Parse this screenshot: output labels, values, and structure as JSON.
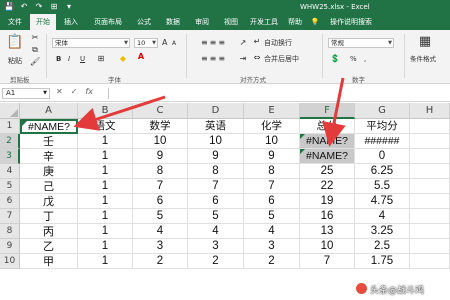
{
  "window": {
    "title": "WHW25.xlsx  -  Excel",
    "qat": [
      "💾",
      "↶",
      "↷",
      "⊞",
      "▾"
    ]
  },
  "tabs": [
    "文件",
    "开始",
    "插入",
    "页面布局",
    "公式",
    "数据",
    "审阅",
    "视图",
    "开发工具",
    "帮助",
    "操作说明搜索"
  ],
  "ribbon": {
    "clipboard": {
      "label": "剪贴板",
      "paste": "粘贴"
    },
    "font": {
      "label": "字体",
      "font_name": "宋体",
      "font_size": "10",
      "bold": "B",
      "italic": "I",
      "underline": "U",
      "grow": "A",
      "shrink": "A"
    },
    "alignment": {
      "label": "对齐方式",
      "wrap": "自动换行",
      "merge": "合并后居中"
    },
    "number": {
      "label": "数字",
      "format": "常规",
      "percent": "%",
      "comma": ","
    },
    "styles": {
      "conditional": "条件格式"
    }
  },
  "formula_bar": {
    "name_box": "A1",
    "cancel": "✕",
    "enter": "✓",
    "fx": "fx",
    "content": ""
  },
  "columns": [
    "A",
    "B",
    "C",
    "D",
    "E",
    "F",
    "G",
    "H"
  ],
  "rows": [
    "1",
    "2",
    "3",
    "4",
    "5",
    "6",
    "7",
    "8",
    "9",
    "10"
  ],
  "cells": [
    [
      "#NAME?",
      "语文",
      "数学",
      "英语",
      "化学",
      "总分",
      "平均分",
      ""
    ],
    [
      "壬",
      "1",
      "10",
      "10",
      "10",
      "#NAME?",
      "######",
      ""
    ],
    [
      "辛",
      "1",
      "9",
      "9",
      "9",
      "#NAME?",
      "0",
      ""
    ],
    [
      "庚",
      "1",
      "8",
      "8",
      "8",
      "25",
      "6.25",
      ""
    ],
    [
      "己",
      "1",
      "7",
      "7",
      "7",
      "22",
      "5.5",
      ""
    ],
    [
      "戊",
      "1",
      "6",
      "6",
      "6",
      "19",
      "4.75",
      ""
    ],
    [
      "丁",
      "1",
      "5",
      "5",
      "5",
      "16",
      "4",
      ""
    ],
    [
      "丙",
      "1",
      "4",
      "4",
      "4",
      "13",
      "3.25",
      ""
    ],
    [
      "乙",
      "1",
      "3",
      "3",
      "3",
      "10",
      "2.5",
      ""
    ],
    [
      "甲",
      "1",
      "2",
      "2",
      "2",
      "7",
      "1.75",
      ""
    ]
  ],
  "watermark": "头条@战斗鸡",
  "colors": {
    "excel_green": "#217346",
    "arrow": "#e33b3b"
  }
}
